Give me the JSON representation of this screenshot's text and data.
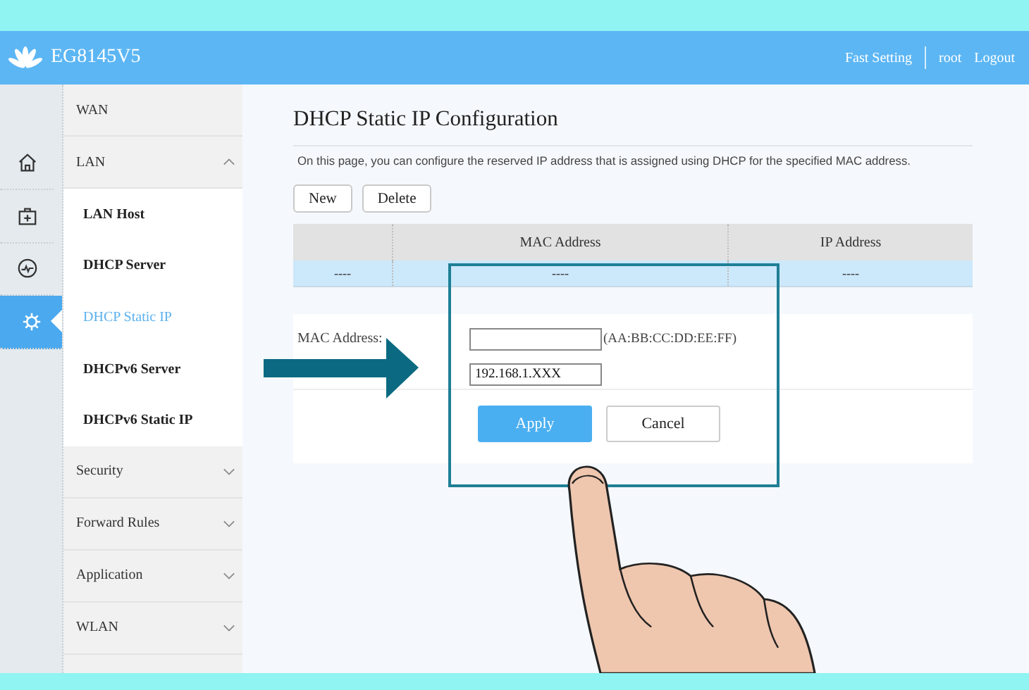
{
  "header": {
    "model": "EG8145V5",
    "links": [
      {
        "label": "Fast Setting"
      },
      {
        "label": "root"
      },
      {
        "label": "Logout"
      }
    ]
  },
  "rail": [
    {
      "kind": "home",
      "selected": false
    },
    {
      "kind": "kit",
      "selected": false
    },
    {
      "kind": "pulse",
      "selected": false
    },
    {
      "kind": "gear",
      "selected": true
    }
  ],
  "menu": [
    {
      "label": "WAN",
      "kind": "link"
    },
    {
      "label": "LAN",
      "kind": "group",
      "expanded": true,
      "children": [
        {
          "label": "LAN Host",
          "selected": false
        },
        {
          "label": "DHCP Server",
          "selected": false
        },
        {
          "label": "DHCP Static IP",
          "selected": true
        },
        {
          "label": "DHCPv6 Server",
          "selected": false
        },
        {
          "label": "DHCPv6 Static IP",
          "selected": false
        }
      ]
    },
    {
      "label": "Security",
      "kind": "group",
      "expanded": false
    },
    {
      "label": "Forward Rules",
      "kind": "group",
      "expanded": false
    },
    {
      "label": "Application",
      "kind": "group",
      "expanded": false
    },
    {
      "label": "WLAN",
      "kind": "group",
      "expanded": false
    }
  ],
  "page": {
    "title": "DHCP Static IP Configuration",
    "description": "On this page, you can configure the reserved IP address that is assigned using DHCP for the specified MAC address.",
    "buttons": [
      {
        "label": "New"
      },
      {
        "label": "Delete"
      }
    ],
    "table": {
      "columns": [
        {},
        {
          "label": "MAC Address"
        },
        {
          "label": "IP Address"
        }
      ],
      "rows": [
        {
          "cells": [
            "----",
            "----",
            "----"
          ],
          "selected": true
        }
      ]
    },
    "form": {
      "fields": [
        {
          "label": "MAC Address:",
          "format_hint": "(AA:BB:CC:DD:EE:FF)"
        },
        {
          "value": "192.168.1.XXX"
        }
      ],
      "buttons": [
        {
          "label": "Apply",
          "kind": "primary"
        },
        {
          "label": "Cancel",
          "kind": "secondary"
        }
      ]
    }
  }
}
